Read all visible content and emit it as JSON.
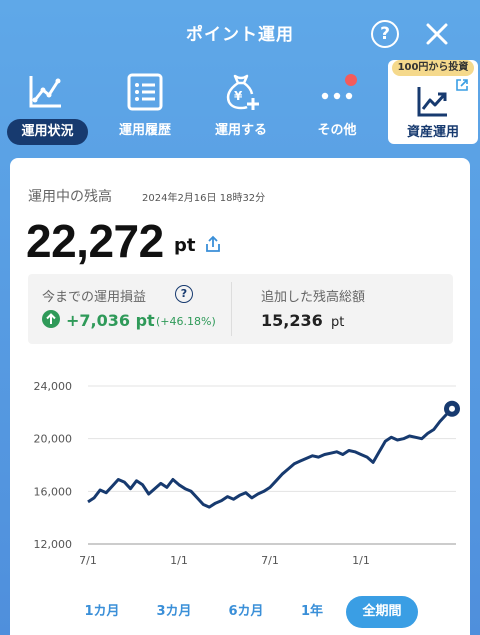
{
  "header": {
    "title": "ポイント運用",
    "help_label": "?"
  },
  "nav": {
    "items": [
      {
        "label": "運用状況",
        "icon": "line-chart-icon",
        "active": true
      },
      {
        "label": "運用履歴",
        "icon": "list-icon"
      },
      {
        "label": "運用する",
        "icon": "yen-bag-plus-icon"
      },
      {
        "label": "その他",
        "icon": "more-dots-icon"
      }
    ],
    "asset": {
      "tag": "100円から投資",
      "label": "資産運用",
      "icon": "asset-chart-icon"
    }
  },
  "balance": {
    "title": "運用中の残高",
    "timestamp": "2024年2月16日 18時32分",
    "amount": "22,272",
    "unit": "pt"
  },
  "summary": {
    "profit_label": "今までの運用損益",
    "help_label": "?",
    "profit_value": "+7,036 pt",
    "profit_pct": "(+46.18%)",
    "added_label": "追加した残高総額",
    "added_value": "15,236",
    "added_unit": "pt"
  },
  "colors": {
    "line": "#173a6f",
    "profit": "#2f9a59",
    "accent": "#3a9ee4"
  },
  "chart_data": {
    "type": "line",
    "x": [
      0,
      6,
      12,
      18,
      24,
      30,
      36,
      42,
      48,
      54,
      60,
      66,
      72,
      78,
      84,
      90,
      96,
      102,
      108,
      114,
      120,
      126,
      132,
      138,
      144,
      150,
      156,
      162,
      168,
      174,
      180,
      186,
      192,
      198,
      204,
      210,
      216,
      222,
      228,
      234,
      240,
      246,
      252,
      258,
      264,
      270,
      276,
      282,
      288,
      294,
      300,
      306,
      312,
      318,
      324,
      330,
      336,
      342,
      348,
      354,
      360
    ],
    "x_tick_positions": [
      0,
      90,
      180,
      270
    ],
    "x_tick_labels": [
      "7/1",
      "1/1",
      "7/1",
      "1/1"
    ],
    "values": [
      15200,
      15500,
      16100,
      15900,
      16400,
      16900,
      16700,
      16200,
      16800,
      16500,
      15800,
      16200,
      16600,
      16300,
      16900,
      16500,
      16200,
      16000,
      15500,
      15000,
      14800,
      15100,
      15300,
      15600,
      15400,
      15700,
      15900,
      15500,
      15800,
      16000,
      16300,
      16800,
      17300,
      17700,
      18100,
      18300,
      18500,
      18700,
      18600,
      18800,
      18900,
      19000,
      18800,
      19100,
      19000,
      18800,
      18600,
      18200,
      19000,
      19800,
      20100,
      19900,
      20000,
      20200,
      20100,
      20000,
      20400,
      20700,
      21300,
      21800,
      22272
    ],
    "ylim": [
      12000,
      24000
    ],
    "y_ticks": [
      "24,000",
      "20,000",
      "16,000",
      "12,000"
    ],
    "y_tick_values": [
      24000,
      20000,
      16000,
      12000
    ],
    "grid": true
  },
  "periods": {
    "items": [
      "1カ月",
      "3カ月",
      "6カ月",
      "1年",
      "全期間"
    ],
    "active": 4
  }
}
